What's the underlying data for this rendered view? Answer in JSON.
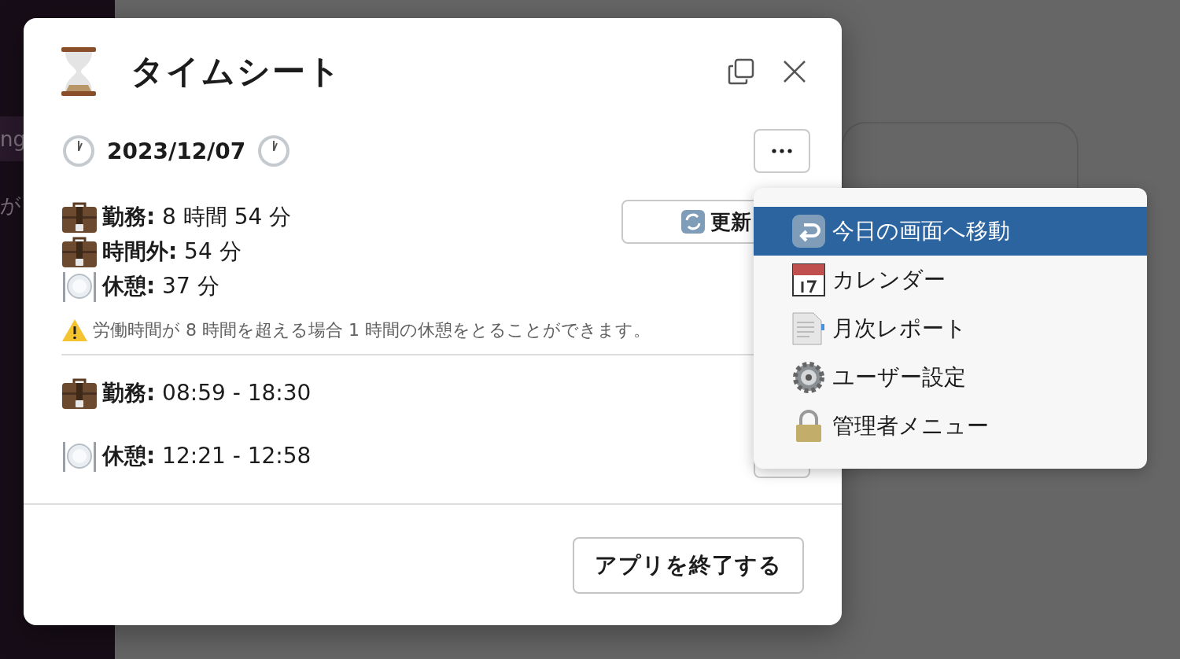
{
  "sidebar": {
    "items": [
      {
        "label": "ng",
        "selected": true
      },
      {
        "label": "が",
        "selected": false
      }
    ]
  },
  "dialog": {
    "title": "タイムシート",
    "date": "2023/12/07",
    "summary": [
      {
        "kind": "work",
        "text": "**勤務:** 8 時間 54 分"
      },
      {
        "kind": "work",
        "text": "**時間外:** 54 分"
      },
      {
        "kind": "break",
        "text": "**休憩:** 37 分"
      }
    ],
    "refresh_button": "更新",
    "notice": "労働時間が 8 時間を超える場合 1 時間の休憩をとることができます。",
    "entries": [
      {
        "kind": "work",
        "text": "**勤務:** 08:59 - 18:30"
      },
      {
        "kind": "break",
        "text": "**休憩:** 12:21 - 12:58"
      }
    ],
    "footer_button": "アプリを終了する"
  },
  "menu": {
    "items": [
      {
        "kind": "return",
        "label": "今日の画面へ移動",
        "selected": true
      },
      {
        "kind": "calendar",
        "label": "カレンダー",
        "selected": false
      },
      {
        "kind": "document",
        "label": "月次レポート",
        "selected": false
      },
      {
        "kind": "gear",
        "label": "ユーザー設定",
        "selected": false
      },
      {
        "kind": "lock",
        "label": "管理者メニュー",
        "selected": false
      }
    ]
  }
}
